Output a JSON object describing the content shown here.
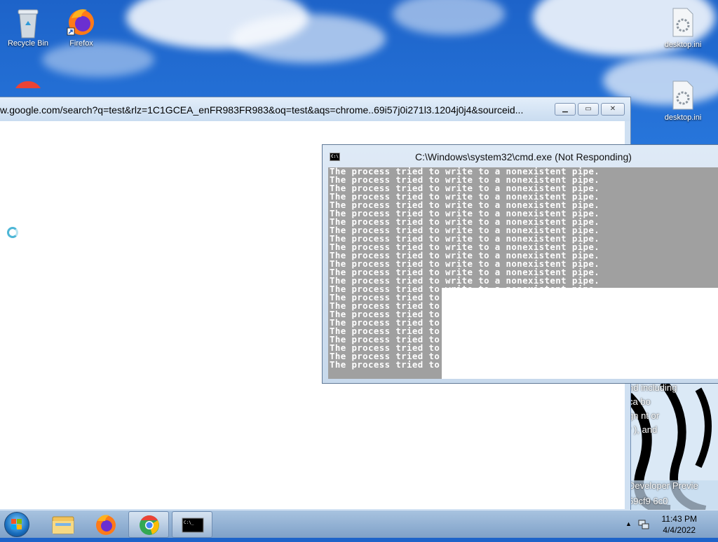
{
  "desktop": {
    "icons": [
      {
        "label": "Recycle Bin"
      },
      {
        "label": "Firefox"
      },
      {
        "label": "desktop.ini"
      },
      {
        "label": "desktop.ini"
      }
    ]
  },
  "chrome_window": {
    "title": "w.google.com/search?q=test&rlz=1C1GCEA_enFR983FR983&oq=test&aqs=chrome..69i57j0i271l3.1204j0j4&sourceid..."
  },
  "cmd_window": {
    "title": "C:\\Windows\\system32\\cmd.exe (Not Responding)",
    "full_line": "The process tried to write to a nonexistent pipe.",
    "partial_line": "The process tried to",
    "full_line_count": 14,
    "partial_line_count": 10
  },
  "background_strip": {
    "texts": [
      "nd including",
      "ca bo",
      "gn nt or",
      "r  ), and",
      "Developer Previe",
      "59cf9     6c0"
    ]
  },
  "taskbar": {
    "time": "11:43 PM",
    "date": "4/4/2022",
    "apps": [
      "explorer",
      "firefox",
      "chrome",
      "cmd"
    ]
  },
  "colors": {
    "console_bg": "#a0a0a0",
    "console_fg": "#ffffff",
    "desktop_blue": "#2a7be0"
  }
}
